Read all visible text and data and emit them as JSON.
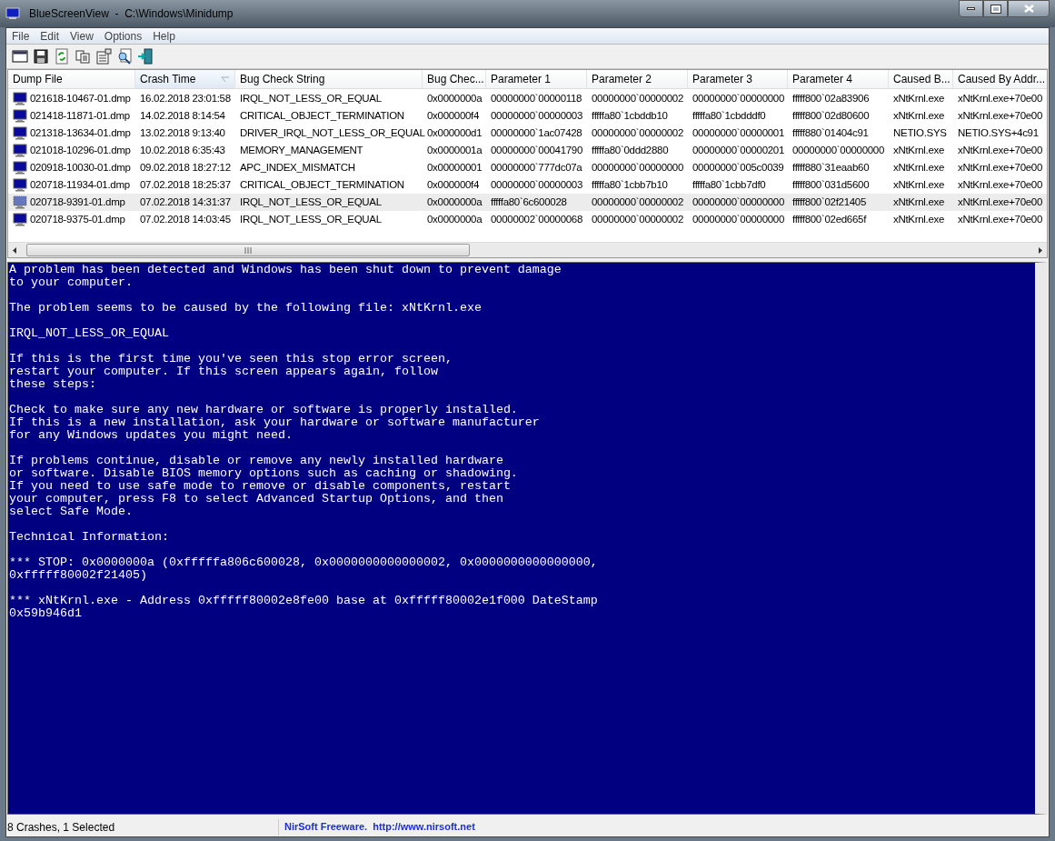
{
  "window": {
    "title": "BlueScreenView  -  C:\\Windows\\Minidump"
  },
  "menu": [
    "File",
    "Edit",
    "View",
    "Options",
    "Help"
  ],
  "toolbar": [
    {
      "kind": "window"
    },
    {
      "kind": "save"
    },
    {
      "kind": "refresh"
    },
    {
      "kind": "copy"
    },
    {
      "kind": "properties"
    },
    {
      "kind": "search"
    },
    {
      "kind": "exit"
    }
  ],
  "table": {
    "columns": [
      {
        "label": "Dump File",
        "sorted": false
      },
      {
        "label": "Crash Time",
        "sorted": true
      },
      {
        "label": "Bug Check String",
        "sorted": false
      },
      {
        "label": "Bug Chec...",
        "sorted": false
      },
      {
        "label": "Parameter 1",
        "sorted": false
      },
      {
        "label": "Parameter 2",
        "sorted": false
      },
      {
        "label": "Parameter 3",
        "sorted": false
      },
      {
        "label": "Parameter 4",
        "sorted": false
      },
      {
        "label": "Caused B...",
        "sorted": false
      },
      {
        "label": "Caused By Addr...",
        "sorted": false
      }
    ],
    "rows": [
      {
        "selected": false,
        "cells": [
          "021618-10467-01.dmp",
          "16.02.2018 23:01:58",
          "IRQL_NOT_LESS_OR_EQUAL",
          "0x0000000a",
          "00000000`00000118",
          "00000000`00000002",
          "00000000`00000000",
          "fffff800`02a83906",
          "xNtKrnl.exe",
          "xNtKrnl.exe+70e00"
        ]
      },
      {
        "selected": false,
        "cells": [
          "021418-11871-01.dmp",
          "14.02.2018 8:14:54",
          "CRITICAL_OBJECT_TERMINATION",
          "0x000000f4",
          "00000000`00000003",
          "fffffa80`1cbddb10",
          "fffffa80`1cbdddf0",
          "fffff800`02d80600",
          "xNtKrnl.exe",
          "xNtKrnl.exe+70e00"
        ]
      },
      {
        "selected": false,
        "cells": [
          "021318-13634-01.dmp",
          "13.02.2018 9:13:40",
          "DRIVER_IRQL_NOT_LESS_OR_EQUAL",
          "0x000000d1",
          "00000000`1ac07428",
          "00000000`00000002",
          "00000000`00000001",
          "fffff880`01404c91",
          "NETIO.SYS",
          "NETIO.SYS+4c91"
        ]
      },
      {
        "selected": false,
        "cells": [
          "021018-10296-01.dmp",
          "10.02.2018 6:35:43",
          "MEMORY_MANAGEMENT",
          "0x0000001a",
          "00000000`00041790",
          "fffffa80`0ddd2880",
          "00000000`00000201",
          "00000000`00000000",
          "xNtKrnl.exe",
          "xNtKrnl.exe+70e00"
        ]
      },
      {
        "selected": false,
        "cells": [
          "020918-10030-01.dmp",
          "09.02.2018 18:27:12",
          "APC_INDEX_MISMATCH",
          "0x00000001",
          "00000000`777dc07a",
          "00000000`00000000",
          "00000000`005c0039",
          "fffff880`31eaab60",
          "xNtKrnl.exe",
          "xNtKrnl.exe+70e00"
        ]
      },
      {
        "selected": false,
        "cells": [
          "020718-11934-01.dmp",
          "07.02.2018 18:25:37",
          "CRITICAL_OBJECT_TERMINATION",
          "0x000000f4",
          "00000000`00000003",
          "fffffa80`1cbb7b10",
          "fffffa80`1cbb7df0",
          "fffff800`031d5600",
          "xNtKrnl.exe",
          "xNtKrnl.exe+70e00"
        ]
      },
      {
        "selected": true,
        "cells": [
          "020718-9391-01.dmp",
          "07.02.2018 14:31:37",
          "IRQL_NOT_LESS_OR_EQUAL",
          "0x0000000a",
          "fffffa80`6c600028",
          "00000000`00000002",
          "00000000`00000000",
          "fffff800`02f21405",
          "xNtKrnl.exe",
          "xNtKrnl.exe+70e00"
        ]
      },
      {
        "selected": false,
        "cells": [
          "020718-9375-01.dmp",
          "07.02.2018 14:03:45",
          "IRQL_NOT_LESS_OR_EQUAL",
          "0x0000000a",
          "00000002`00000068",
          "00000000`00000002",
          "00000000`00000000",
          "fffff800`02ed665f",
          "xNtKrnl.exe",
          "xNtKrnl.exe+70e00"
        ]
      }
    ]
  },
  "bluescreen": [
    "A problem has been detected and Windows has been shut down to prevent damage\nto your computer.",
    "The problem seems to be caused by the following file: xNtKrnl.exe",
    "IRQL_NOT_LESS_OR_EQUAL",
    "If this is the first time you've seen this stop error screen,\nrestart your computer. If this screen appears again, follow\nthese steps:",
    "Check to make sure any new hardware or software is properly installed.\nIf this is a new installation, ask your hardware or software manufacturer\nfor any Windows updates you might need.",
    "If problems continue, disable or remove any newly installed hardware\nor software. Disable BIOS memory options such as caching or shadowing.\nIf you need to use safe mode to remove or disable components, restart\nyour computer, press F8 to select Advanced Startup Options, and then\nselect Safe Mode.",
    "Technical Information:",
    "*** STOP: 0x0000000a (0xfffffa806c600028, 0x0000000000000002, 0x0000000000000000,\n0xfffff80002f21405)",
    "*** xNtKrnl.exe - Address 0xfffff80002e8fe00 base at 0xfffff80002e1f000 DateStamp\n0x59b946d1"
  ],
  "status_bar": {
    "summary": "8 Crashes, 1 Selected",
    "link": "NirSoft Freeware.  http://www.nirsoft.net"
  }
}
